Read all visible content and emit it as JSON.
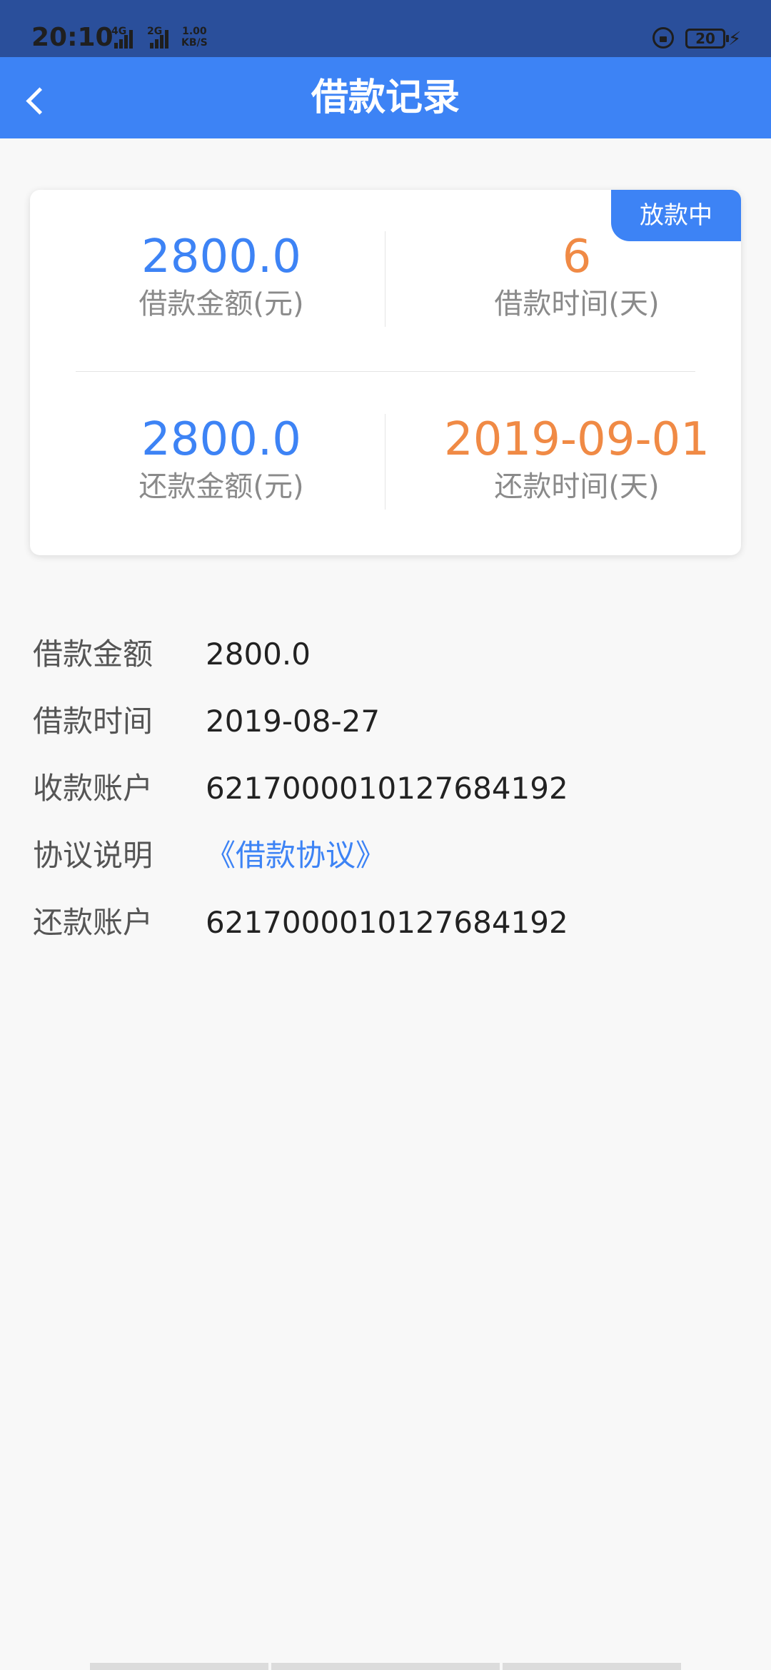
{
  "status_bar": {
    "time": "20:10",
    "network_1": "4G",
    "network_2": "2G",
    "speed_value": "1.00",
    "speed_unit": "KB/S",
    "battery": "20"
  },
  "header": {
    "title": "借款记录",
    "back_icon": "chevron-left-icon"
  },
  "summary": {
    "status_badge": "放款中",
    "loan_amount_value": "2800.0",
    "loan_amount_label": "借款金额(元)",
    "loan_days_value": "6",
    "loan_days_label": "借款时间(天)",
    "repay_amount_value": "2800.0",
    "repay_amount_label": "还款金额(元)",
    "repay_date_value": "2019-09-01",
    "repay_date_label": "还款时间(天)"
  },
  "details": {
    "loan_amount_label": "借款金额",
    "loan_amount_value": "2800.0",
    "loan_time_label": "借款时间",
    "loan_time_value": "2019-08-27",
    "receive_account_label": "收款账户",
    "receive_account_value": "6217000010127684192",
    "agreement_label": "协议说明",
    "agreement_link": "《借款协议》",
    "repay_account_label": "还款账户",
    "repay_account_value": "6217000010127684192"
  },
  "colors": {
    "primary": "#3d83f5",
    "accent_orange": "#f08a45",
    "status_bar_bg": "#2a4f9b",
    "page_bg": "#f8f8f8"
  }
}
